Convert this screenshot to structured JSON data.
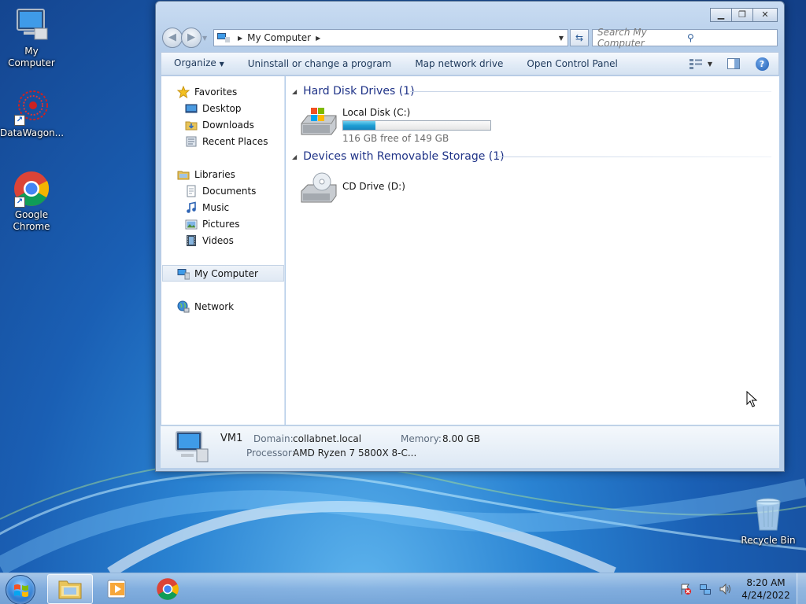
{
  "desktop": {
    "icons": [
      {
        "label": "My Computer"
      },
      {
        "label": "DataWagon..."
      },
      {
        "label": "Google Chrome"
      },
      {
        "label": "Recycle Bin"
      }
    ]
  },
  "window": {
    "address": {
      "path": "My Computer",
      "search_placeholder": "Search My Computer"
    },
    "toolbar": {
      "organize": "Organize",
      "uninstall": "Uninstall or change a program",
      "map_drive": "Map network drive",
      "control_panel": "Open Control Panel"
    },
    "nav_pane": {
      "favorites": "Favorites",
      "desktop": "Desktop",
      "downloads": "Downloads",
      "recent_places": "Recent Places",
      "libraries": "Libraries",
      "documents": "Documents",
      "music": "Music",
      "pictures": "Pictures",
      "videos": "Videos",
      "my_computer": "My Computer",
      "network": "Network"
    },
    "content": {
      "hard_disks_header": "Hard Disk Drives (1)",
      "local_disk": {
        "name": "Local Disk (C:)",
        "free_text": "116 GB free of 149 GB",
        "used_fraction": 0.22
      },
      "removable_header": "Devices with Removable Storage (1)",
      "cd_drive": {
        "name": "CD Drive (D:)"
      }
    },
    "details": {
      "computer_name": "VM1",
      "domain_label": "Domain:",
      "domain_value": "collabnet.local",
      "memory_label": "Memory:",
      "memory_value": "8.00 GB",
      "processor_label": "Processor:",
      "processor_value": "AMD Ryzen 7 5800X 8-C..."
    }
  },
  "taskbar": {
    "clock_time": "8:20 AM",
    "clock_date": "4/24/2022"
  },
  "colors": {
    "capacity_bar": "#1f9fd4",
    "group_header": "#1e3287",
    "toolbar_text": "#1e395b"
  }
}
